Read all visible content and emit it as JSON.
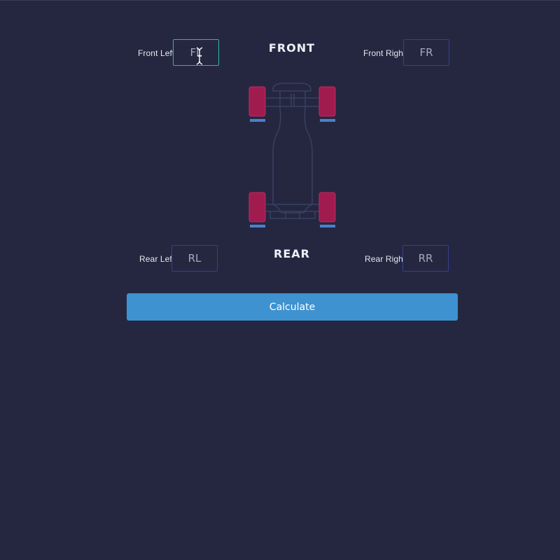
{
  "wheels": {
    "front_left": {
      "label": "Front Left",
      "placeholder": "FL",
      "value": ""
    },
    "front_right": {
      "label": "Front Right",
      "placeholder": "FR",
      "value": ""
    },
    "rear_left": {
      "label": "Rear Left",
      "placeholder": "RL",
      "value": ""
    },
    "rear_right": {
      "label": "Rear Right",
      "placeholder": "RR",
      "value": ""
    }
  },
  "axles": {
    "front": "FRONT",
    "rear": "REAR"
  },
  "actions": {
    "calculate_label": "Calculate"
  },
  "colors": {
    "background": "#252740",
    "input_border": "#34418f",
    "input_focus_border": "#2fb5a5",
    "tire": "#a01c4f",
    "tire_marker": "#4a7fcf",
    "chassis_outline": "#3b4668",
    "button": "#3e92cf"
  },
  "icons": {
    "text_cursor": "text-cursor-icon",
    "car": "car-top-view-icon"
  }
}
